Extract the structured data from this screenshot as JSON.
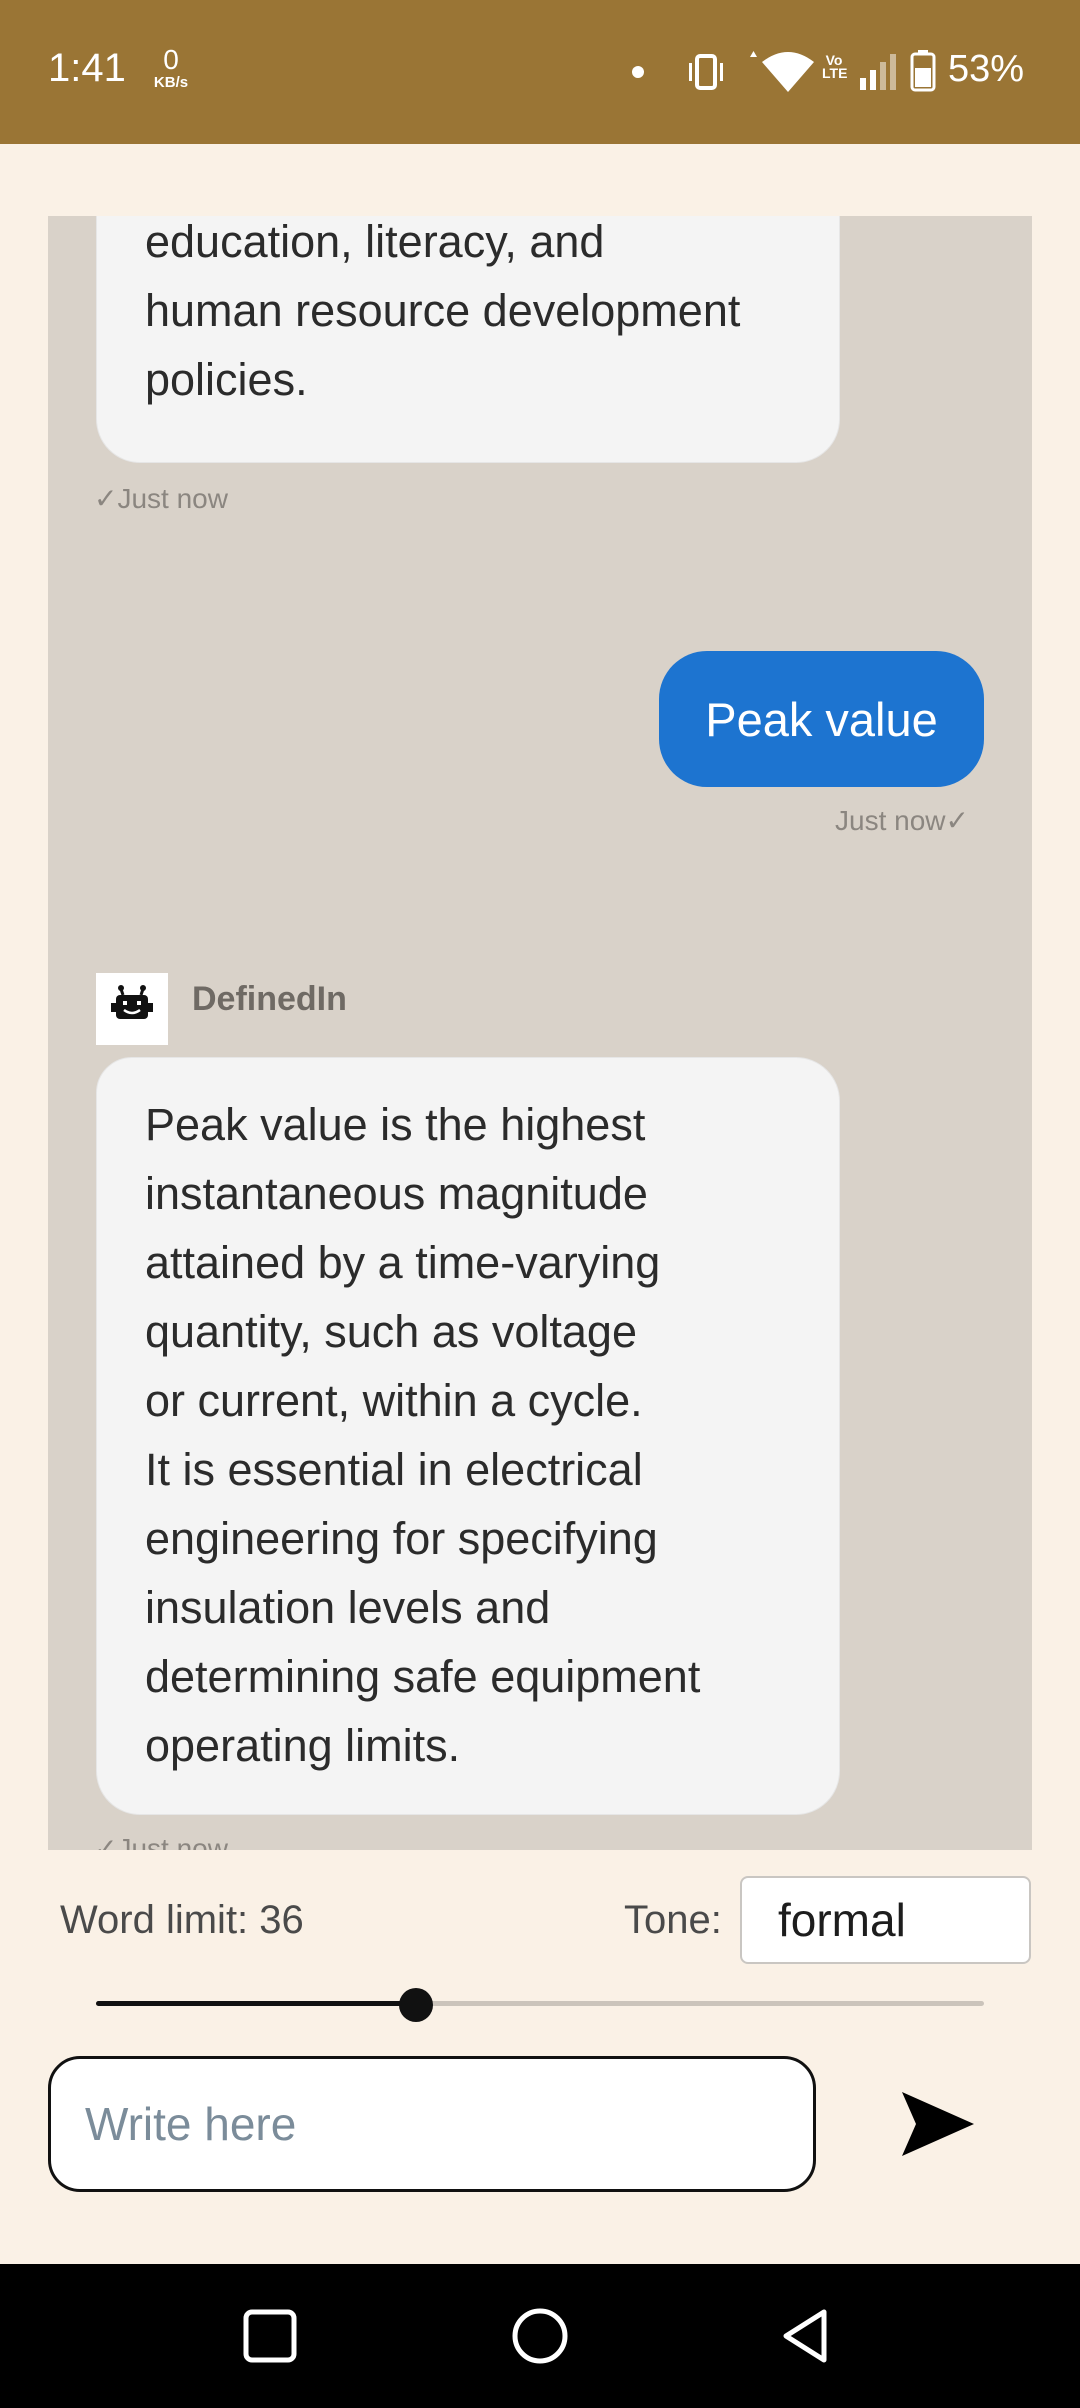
{
  "status_bar": {
    "time": "1:41",
    "net_speed_value": "0",
    "net_speed_unit": "KB/s",
    "volte": "Vo LTE",
    "battery_percent": "53%"
  },
  "chat": {
    "messages": [
      {
        "sender": "bot",
        "lines": [
          "education, literacy, and",
          "human resource development",
          "policies."
        ],
        "timestamp": "✓Just now"
      },
      {
        "sender": "user",
        "text": "Peak value",
        "timestamp": "Just now✓"
      },
      {
        "sender": "bot",
        "sender_name": "DefinedIn",
        "lines": [
          "Peak value is the highest",
          "instantaneous magnitude",
          "attained by a time-varying",
          "quantity, such as voltage",
          "or current, within a cycle.",
          "It is essential in electrical",
          "engineering for specifying",
          "insulation levels and",
          "determining safe equipment",
          "operating limits."
        ],
        "timestamp": "✓Just now"
      }
    ]
  },
  "controls": {
    "word_limit_label": "Word limit: 36",
    "word_limit_slider_fraction": 0.36,
    "tone_label": "Tone:",
    "tone_value": "formal"
  },
  "composer": {
    "placeholder": "Write here"
  },
  "icons": {
    "send": "send-icon",
    "bot_avatar": "robot-icon",
    "nav_recent": "square-icon",
    "nav_home": "circle-icon",
    "nav_back": "triangle-back-icon"
  },
  "colors": {
    "status_bar": "#9a7535",
    "user_bubble": "#1d74d0",
    "chat_background": "#d9d2c9",
    "page_background": "#faf1e6"
  }
}
